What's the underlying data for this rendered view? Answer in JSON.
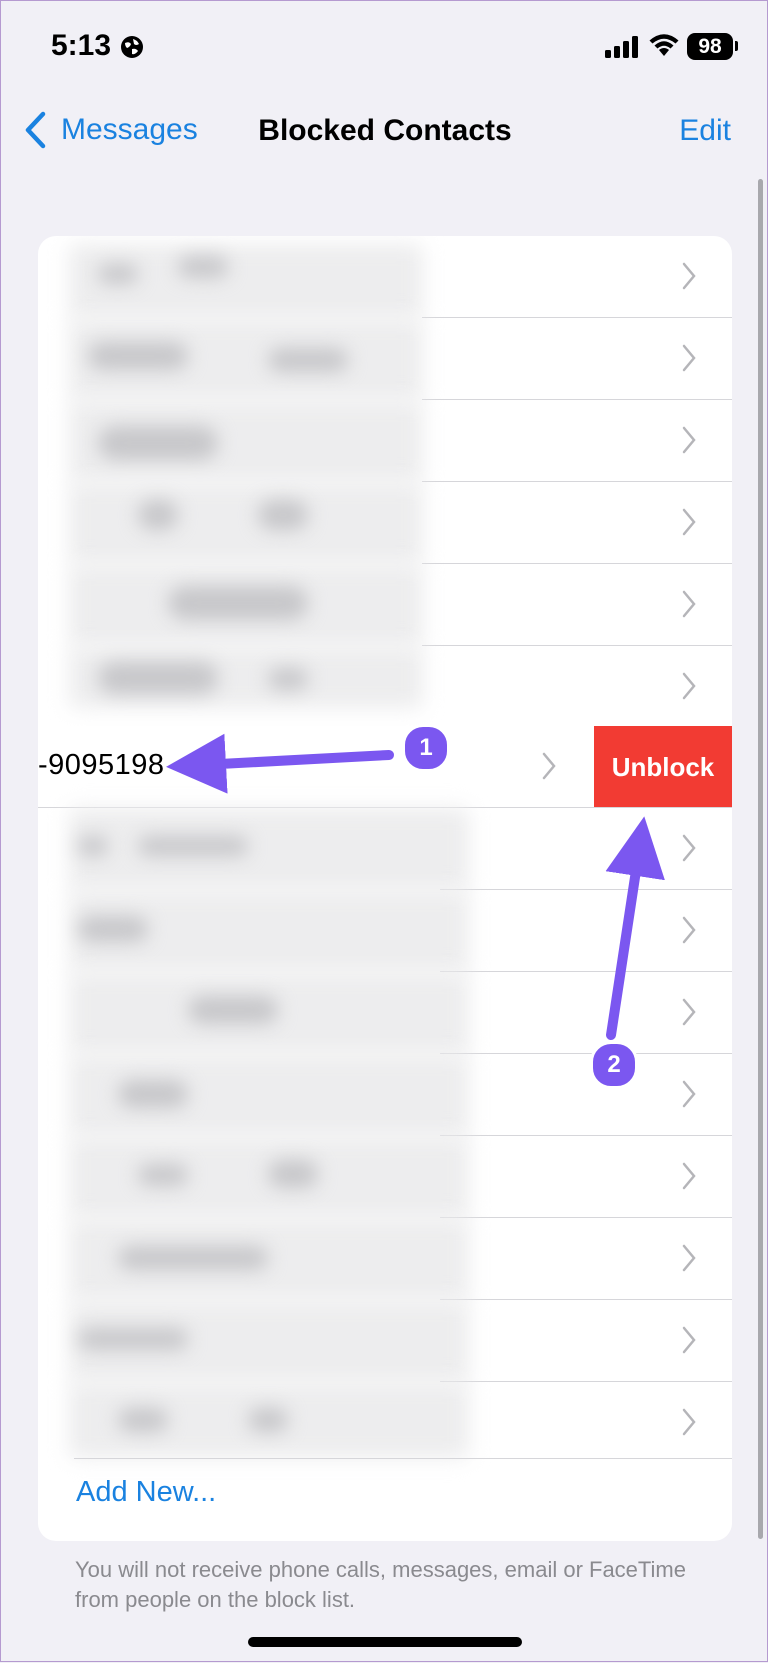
{
  "status_bar": {
    "time": "5:13",
    "battery": "98",
    "globe_icon": "globe-icon",
    "signal_icon": "cellular-signal-icon",
    "wifi_icon": "wifi-icon"
  },
  "nav": {
    "back_label": "Messages",
    "title": "Blocked Contacts",
    "edit_label": "Edit"
  },
  "swiped_contact": {
    "phone": "-9095198",
    "action_label": "Unblock",
    "action_color": "#f23b33"
  },
  "add_new_label": "Add New...",
  "footer_note": "You will not receive phone calls, messages, email or FaceTime from people on the block list.",
  "annotations": [
    {
      "number": "1"
    },
    {
      "number": "2"
    }
  ],
  "colors": {
    "accent": "#1a82e0",
    "annotation": "#7b57f0",
    "background": "#f1f0f6"
  }
}
